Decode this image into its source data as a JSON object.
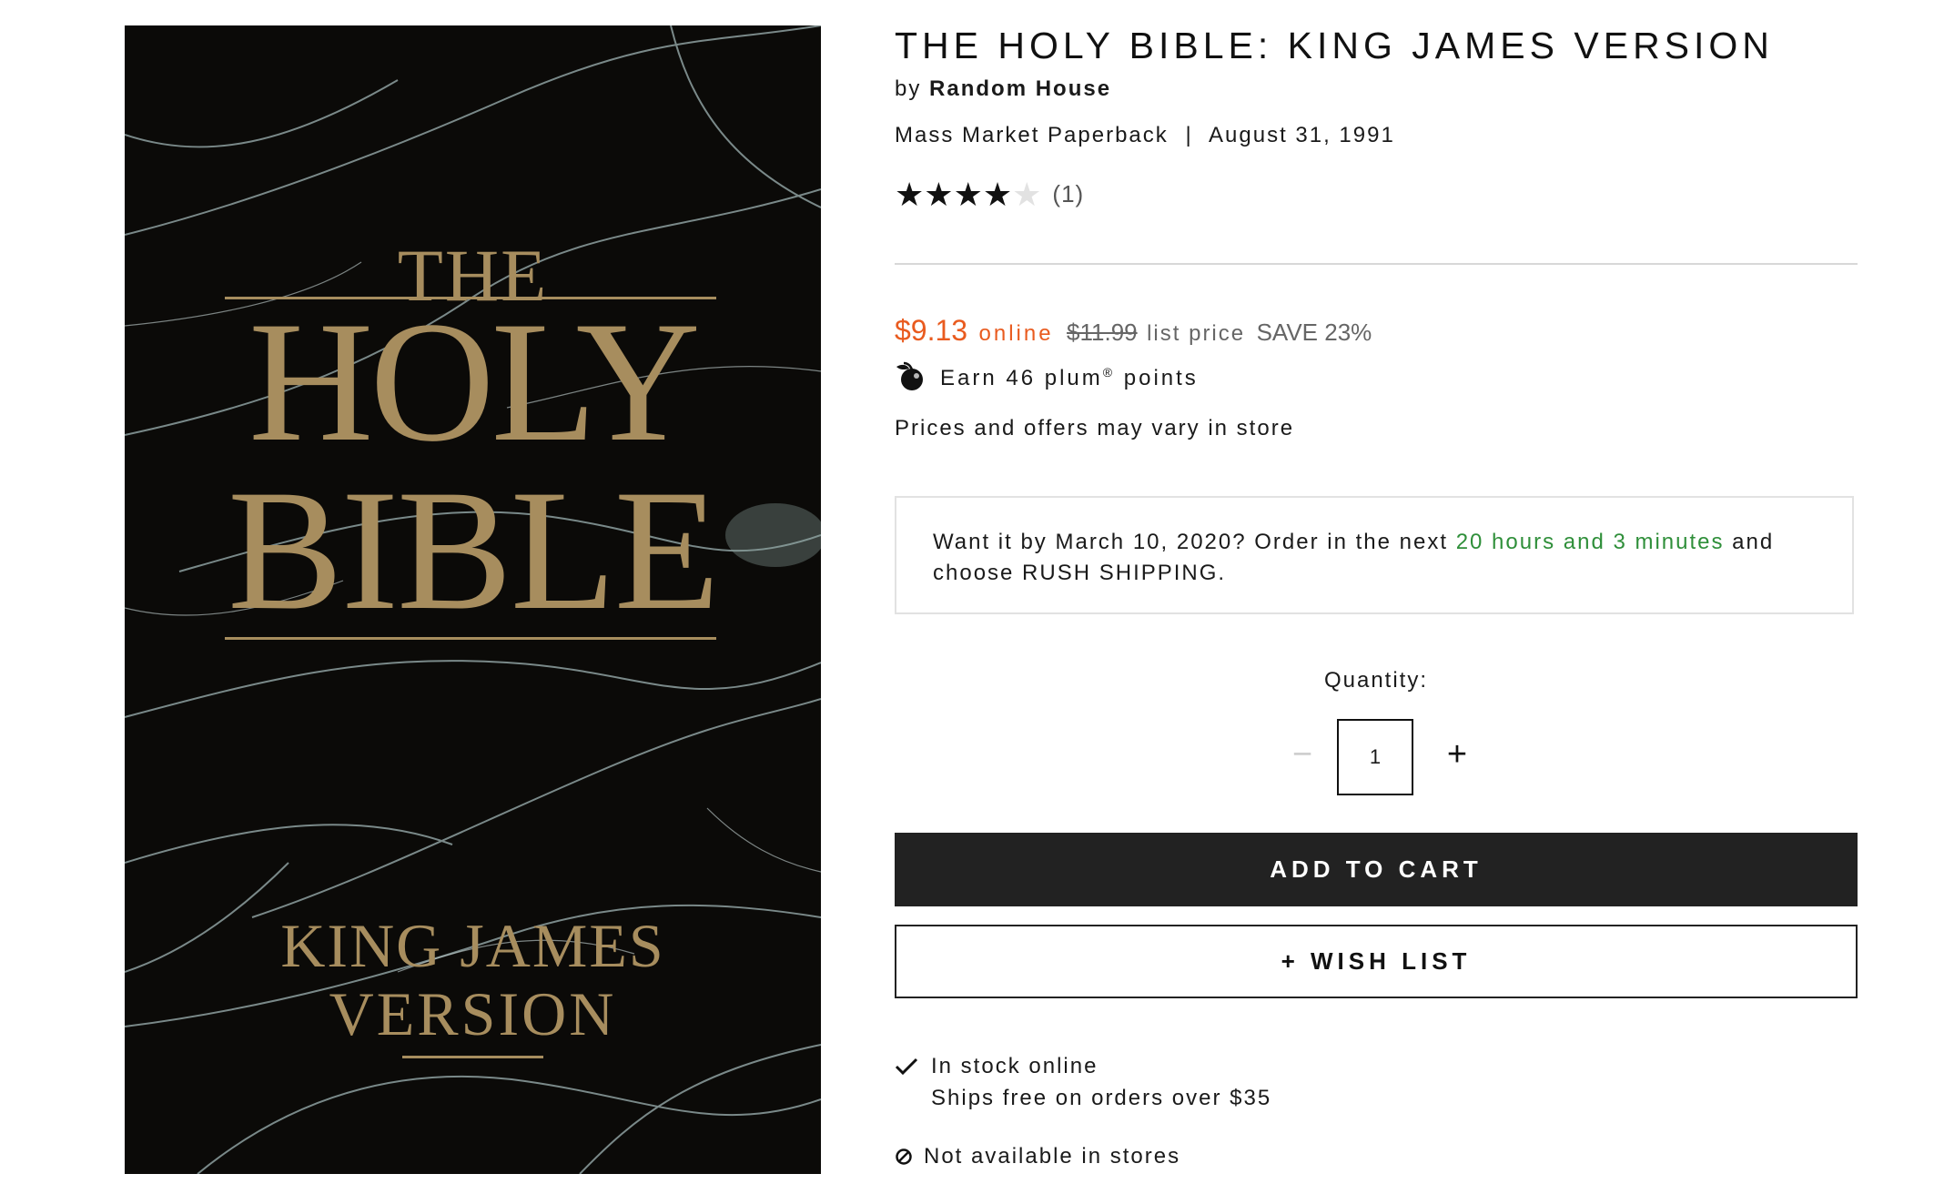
{
  "cover": {
    "line1": "THE",
    "line2": "HOLY",
    "line3": "BIBLE",
    "line4": "KING JAMES",
    "line5": "VERSION"
  },
  "product": {
    "title": "THE HOLY BIBLE: KING JAMES VERSION",
    "by_label": "by",
    "author": "Random House",
    "format": "Mass Market Paperback",
    "separator": "|",
    "date": "August 31, 1991",
    "rating_value": 4,
    "rating_max": 5,
    "rating_count": "(1)"
  },
  "pricing": {
    "price": "$9.13",
    "online_label": "online",
    "list_price": "$11.99",
    "list_label": "list price",
    "save": "SAVE 23%",
    "plum_text_before": "Earn 46 plum",
    "plum_reg": "®",
    "plum_text_after": " points",
    "vary_notice": "Prices and offers may vary in store"
  },
  "shipping": {
    "text_before": "Want it by March 10, 2020? Order in the next ",
    "countdown": "20 hours and 3 minutes",
    "text_after": " and choose RUSH SHIPPING."
  },
  "quantity": {
    "label": "Quantity:",
    "minus": "−",
    "value": "1",
    "plus": "+"
  },
  "actions": {
    "add_to_cart": "ADD TO CART",
    "wish_list": "+ WISH LIST"
  },
  "availability": {
    "in_stock": "In stock online",
    "ships_free": "Ships free on orders over $35",
    "not_in_stores": "Not available in stores"
  },
  "colors": {
    "accent_price": "#e95b1f",
    "countdown_green": "#2f8f3a",
    "cover_gold": "#a78d5e"
  }
}
